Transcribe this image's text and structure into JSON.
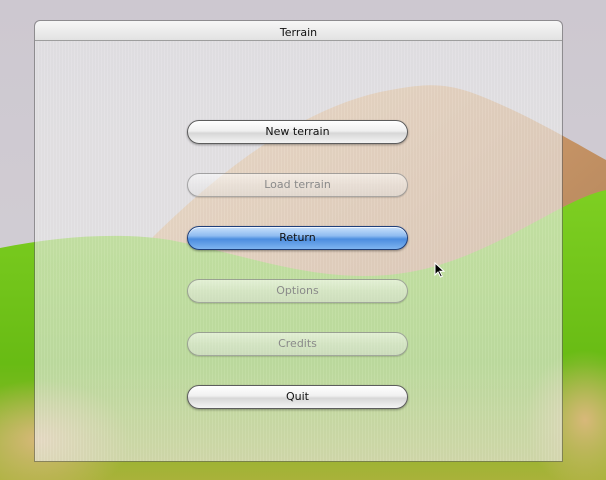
{
  "window": {
    "title": "Terrain"
  },
  "menu": {
    "buttons": [
      {
        "label": "New terrain",
        "state": "normal"
      },
      {
        "label": "Load terrain",
        "state": "disabled"
      },
      {
        "label": "Return",
        "state": "default"
      },
      {
        "label": "Options",
        "state": "disabled"
      },
      {
        "label": "Credits",
        "state": "disabled"
      },
      {
        "label": "Quit",
        "state": "normal"
      }
    ]
  },
  "cursor": {
    "icon": "arrow-cursor-icon"
  },
  "colors": {
    "sky": "#cfcad1",
    "mountain": "#d9a877",
    "grass": "#6fc31c",
    "default_button": "#4c8ddf"
  }
}
